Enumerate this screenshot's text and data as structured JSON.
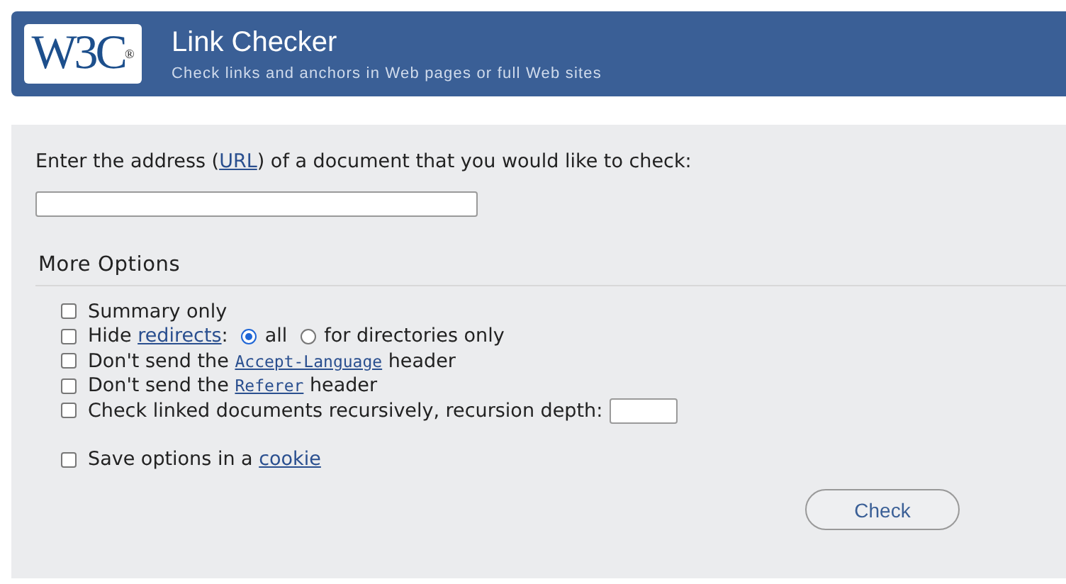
{
  "header": {
    "logo": {
      "text": "W3C",
      "mark": "®"
    },
    "title": "Link Checker",
    "subtitle": "Check links and anchors in Web pages or full Web sites"
  },
  "form": {
    "intro": [
      {
        "kind": "text",
        "text": "Enter the address ("
      },
      {
        "kind": "link",
        "text": "URL"
      },
      {
        "kind": "text",
        "text": ") of a document that you would like to check:"
      }
    ],
    "more_options": {
      "title": "More Options",
      "options": [
        {
          "kind": "plain",
          "checked": false,
          "parts": [
            {
              "kind": "text",
              "text": "Summary only"
            }
          ]
        },
        {
          "kind": "choice",
          "checked": false,
          "parts": [
            {
              "kind": "text",
              "text": "Hide "
            },
            {
              "kind": "link",
              "text": "redirects"
            },
            {
              "kind": "text",
              "text": ":"
            }
          ],
          "radios": [
            {
              "label": "all",
              "selected": true
            },
            {
              "label": "for directories only",
              "selected": false
            }
          ]
        },
        {
          "kind": "plain",
          "checked": false,
          "parts": [
            {
              "kind": "text",
              "text": "Don't send the "
            },
            {
              "kind": "code_link",
              "text": "Accept-Language"
            },
            {
              "kind": "text",
              "text": " header"
            }
          ]
        },
        {
          "kind": "plain",
          "checked": false,
          "parts": [
            {
              "kind": "text",
              "text": "Don't send the "
            },
            {
              "kind": "code_link",
              "text": "Referer"
            },
            {
              "kind": "text",
              "text": " header"
            }
          ]
        },
        {
          "kind": "depth",
          "checked": false,
          "parts": [
            {
              "kind": "text",
              "text": "Check linked documents recursively, recursion depth:"
            }
          ]
        }
      ],
      "save_option": {
        "checked": false,
        "parts": [
          {
            "kind": "text",
            "text": "Save options in a "
          },
          {
            "kind": "link",
            "text": "cookie"
          }
        ]
      }
    },
    "submit": {
      "label": "Check"
    }
  }
}
